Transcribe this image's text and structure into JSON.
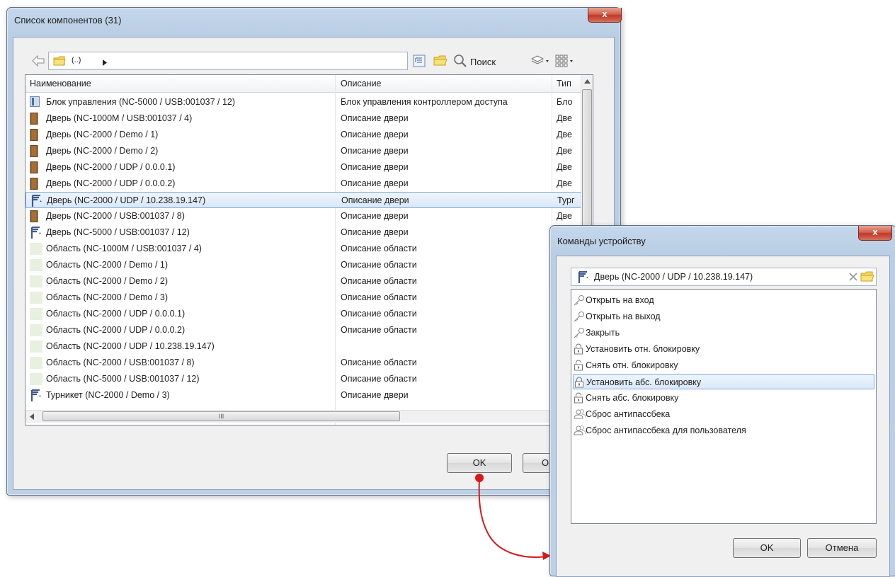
{
  "components_window": {
    "title": "Список компонентов (31)",
    "close_glyph": "x",
    "toolbar": {
      "path_text": "(..)",
      "search_label": "Поиск"
    },
    "columns": [
      "Наименование",
      "Описание",
      "Тип"
    ],
    "rows": [
      {
        "name": "Блок управления (NC-5000 / USB:001037 / 12)",
        "desc": "Блок управления контроллером доступа",
        "type": "Бло",
        "icon": "controller-icon"
      },
      {
        "name": "Дверь (NC-1000M / USB:001037 / 4)",
        "desc": "Описание двери",
        "type": "Две",
        "icon": "door-icon"
      },
      {
        "name": "Дверь (NC-2000 / Demo / 1)",
        "desc": "Описание двери",
        "type": "Две",
        "icon": "door-icon"
      },
      {
        "name": "Дверь (NC-2000 / Demo / 2)",
        "desc": "Описание двери",
        "type": "Две",
        "icon": "door-icon"
      },
      {
        "name": "Дверь (NC-2000 / UDP / 0.0.0.1)",
        "desc": "Описание двери",
        "type": "Две",
        "icon": "door-icon"
      },
      {
        "name": "Дверь (NC-2000 / UDP / 0.0.0.2)",
        "desc": "Описание двери",
        "type": "Две",
        "icon": "door-icon"
      },
      {
        "name": "Дверь (NC-2000 / UDP / 10.238.19.147)",
        "desc": "Описание двери",
        "type": "Тург",
        "icon": "turnstile-icon",
        "selected": true
      },
      {
        "name": "Дверь (NC-2000 / USB:001037 / 8)",
        "desc": "Описание двери",
        "type": "Две",
        "icon": "door-icon"
      },
      {
        "name": "Дверь (NC-5000 / USB:001037 / 12)",
        "desc": "Описание двери",
        "type": "",
        "icon": "turnstile-icon"
      },
      {
        "name": "Область (NC-1000M / USB:001037 / 4)",
        "desc": "Описание области",
        "type": "",
        "icon": "area-icon"
      },
      {
        "name": "Область (NC-2000 / Demo / 1)",
        "desc": "Описание области",
        "type": "",
        "icon": "area-icon"
      },
      {
        "name": "Область (NC-2000 / Demo / 2)",
        "desc": "Описание области",
        "type": "",
        "icon": "area-icon"
      },
      {
        "name": "Область (NC-2000 / Demo / 3)",
        "desc": "Описание области",
        "type": "",
        "icon": "area-icon"
      },
      {
        "name": "Область (NC-2000 / UDP / 0.0.0.1)",
        "desc": "Описание области",
        "type": "",
        "icon": "area-icon"
      },
      {
        "name": "Область (NC-2000 / UDP / 0.0.0.2)",
        "desc": "Описание области",
        "type": "",
        "icon": "area-icon"
      },
      {
        "name": "Область (NC-2000 / UDP / 10.238.19.147)",
        "desc": "",
        "type": "",
        "icon": "area-icon"
      },
      {
        "name": "Область (NC-2000 / USB:001037 / 8)",
        "desc": "Описание области",
        "type": "",
        "icon": "area-icon"
      },
      {
        "name": "Область (NC-5000 / USB:001037 / 12)",
        "desc": "Описание области",
        "type": "",
        "icon": "area-icon"
      },
      {
        "name": "Турникет (NC-2000 / Demo / 3)",
        "desc": "Описание двери",
        "type": "",
        "icon": "turnstile-icon"
      }
    ],
    "hscroll_grip": "III",
    "ok_label": "OK",
    "cancel_label_partial": "O"
  },
  "commands_window": {
    "title": "Команды устройству",
    "close_glyph": "x",
    "device": "Дверь (NC-2000 / UDP / 10.238.19.147)",
    "commands": [
      {
        "label": "Открыть на вход",
        "icon": "key-icon"
      },
      {
        "label": "Открыть на выход",
        "icon": "key-icon"
      },
      {
        "label": "Закрыть",
        "icon": "key-icon"
      },
      {
        "label": "Установить отн. блокировку",
        "icon": "lock-icon"
      },
      {
        "label": "Снять отн. блокировку",
        "icon": "unlock-icon"
      },
      {
        "label": "Установить абс. блокировку",
        "icon": "lock-icon",
        "selected": true
      },
      {
        "label": "Снять абс. блокировку",
        "icon": "unlock-icon"
      },
      {
        "label": "Сброс антипассбека",
        "icon": "users-icon"
      },
      {
        "label": "Сброс антипассбека для пользователя",
        "icon": "users-icon"
      }
    ],
    "ok_label": "OK",
    "cancel_label": "Отмена"
  },
  "colors": {
    "accent_arrow": "#d7191c",
    "selection_border": "#84acdd",
    "door_brown": "#8b5a2b",
    "turnstile_blue": "#3f5a8c"
  }
}
